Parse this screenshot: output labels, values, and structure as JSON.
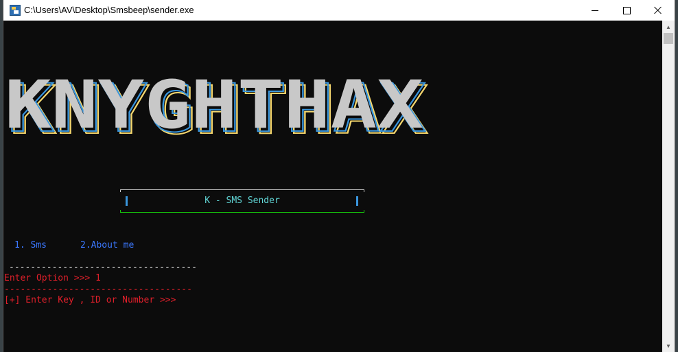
{
  "window": {
    "title": "C:\\Users\\AV\\Desktop\\Smsbeep\\sender.exe",
    "icon": "console-app-icon",
    "controls": {
      "minimize": "minimize-icon",
      "maximize": "maximize-icon",
      "close": "close-icon"
    }
  },
  "console": {
    "background": "#0c0c0c",
    "banner": {
      "text": "KNYGHTHAX",
      "fill": "#c8c8c8",
      "outline_colors": [
        "#f5d76e",
        "#3a96dd",
        "#cccccc"
      ]
    },
    "title_box": {
      "label": "K - SMS Sender",
      "label_color": "#61d6d6",
      "border_top_color": "#cccccc",
      "border_bottom_color": "#16c60c"
    },
    "menu": [
      {
        "label": "1. Sms"
      },
      {
        "label": "2.About me"
      }
    ],
    "menu_color": "#3b78ff",
    "separator_1": "-----------------------------------",
    "prompt": "Enter Option >>> 1",
    "separator_2": "-----------------------------------",
    "input_prompt": "[+] Enter Key , ID or Number >>>",
    "prompt_color": "#e01f2a"
  },
  "scrollbar": {
    "up": "scroll-up-arrow-icon",
    "down": "scroll-down-arrow-icon"
  }
}
